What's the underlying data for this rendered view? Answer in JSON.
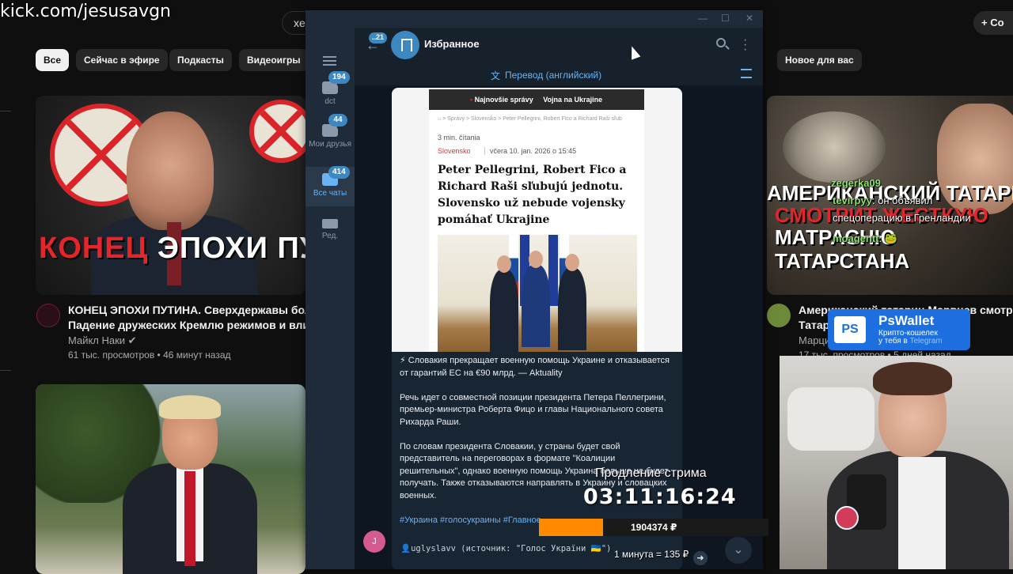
{
  "stream": {
    "watermark": "kick.com/jesusavgn",
    "timer_label": "Продление стрима",
    "timer_value": "03:11:16:24",
    "goal_amount": "1904374 ₽",
    "goal_progress": 0.28,
    "rate": "1 минута = 135 ₽"
  },
  "youtube": {
    "search_stub": "xe",
    "create_label": "+ Со",
    "chips": [
      "Все",
      "Сейчас в эфире",
      "Подкасты",
      "Видеоигры",
      "Новое для вас"
    ],
    "videos": [
      {
        "thumb_title_red": "КОНЕЦ",
        "thumb_title_rest": " ЭПОХИ ПУ",
        "title_line1": "КОНЕЦ ЭПОХИ ПУТИНА. Сверхдержавы больш",
        "title_line2": "Падение дружеских Кремлю режимов и влиян",
        "channel": "Майкл Наки ✔",
        "meta": "61 тыс. просмотров • 46 минут назад"
      },
      {
        "title_line1": "Американский татарин Марвцев смотрит м",
        "title_line2": "Татар",
        "channel": "Марци",
        "meta": "17 тыс. просмотров • 5 дней назад",
        "thumb_caption1": "АМЕРИКАНСКИЙ ТАТАРИН",
        "thumb_caption2": "СМОТРИТ ЖЕСТКУЮ",
        "thumb_caption3": "МАТРАСНЮ",
        "thumb_caption4": "ТАТАРСТАНА"
      }
    ],
    "chat": [
      {
        "nick": "zegerka09",
        "text": ""
      },
      {
        "nick": "tevirpyy",
        "text": ": он объявил"
      },
      {
        "nick": "",
        "text": "спецоперацию в Гренландии"
      },
      {
        "nick": "moagentt",
        "text": ": 🐸"
      }
    ]
  },
  "telegram": {
    "back_badge": "21",
    "chat_title": "Избранное",
    "translate_label": "Перевод (английский)",
    "rail": [
      {
        "label": "dct",
        "badge": "194"
      },
      {
        "label": "Мои друзья",
        "badge": "44"
      },
      {
        "label": "Все чаты",
        "badge": "414"
      },
      {
        "label": "Ред.",
        "badge": ""
      }
    ],
    "article": {
      "nav1": "Najnovšie správy",
      "nav2": "Vojna na Ukrajine",
      "crumbs": "⌂ > Správy > Slovensko > Peter Pellegrini, Robert Fico a Richard Raši sľub",
      "read_time": "3 min. čítania",
      "category": "Slovensko",
      "date": "včera 10. jan. 2026 o 15:45",
      "headline": "Peter Pellegrini, Robert Fico a Richard Raši sľubujú jednotu. Slovensko už nebude vojensky pomáhať Ukrajine"
    },
    "message": {
      "p1": "⚡ Словакия прекращает военную помощь Украине и отказывается от гарантий ЕС на €90 млрд. — Aktuality",
      "p2": "Речь идет о совместной позиции президента Петера Пеллегрини, премьер-министра Роберта Фицо и главы Национального совета Рихарда Раши.",
      "p3": "По словам президента Словакии, у страны будет свой представитель на переговорах в формате \"Коалиции решительных\", однако военную помощь Украина больше не будет получать. Также отказываются направлять в Украину и словацких военных.",
      "tags": "#Украина #голосукраины #Главное",
      "forward": "👤uglyslavv (источник: \"Голос України 🇺🇦\")",
      "sender_initial": "J"
    }
  },
  "ps_wallet": {
    "logo": "PS",
    "title": "PsWallet",
    "sub1": "Крипто-кошелек",
    "sub2_prefix": "у тебя в ",
    "sub2_highlight": "Telegram"
  }
}
